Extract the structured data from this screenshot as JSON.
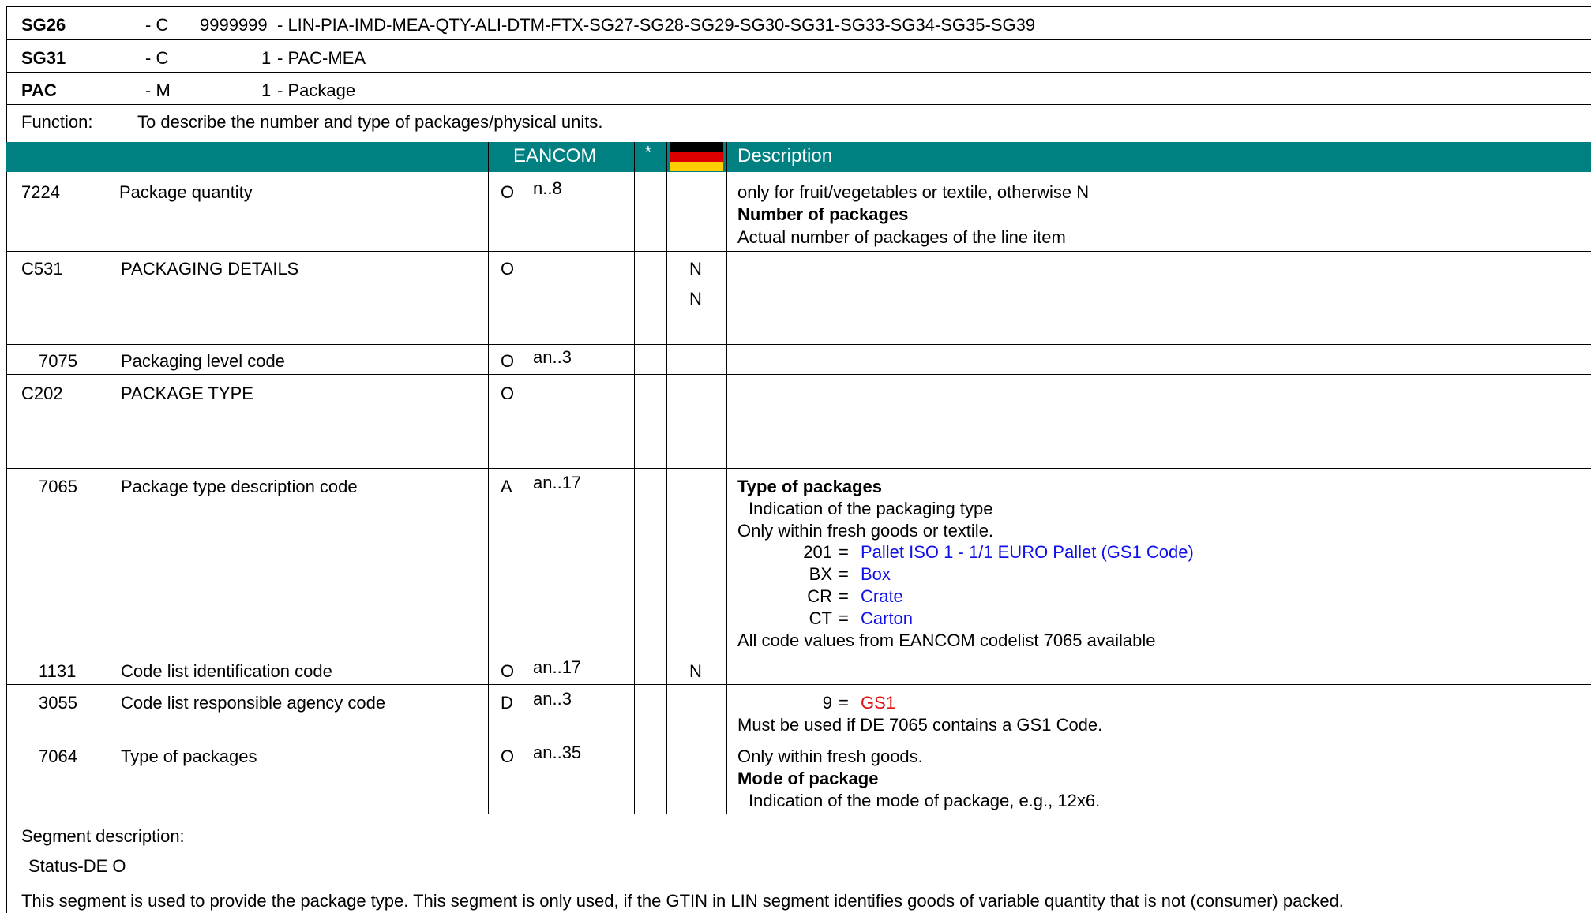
{
  "header_rows": [
    {
      "code": "SG26",
      "status": "- C",
      "repeat": "9999999",
      "desc": "- LIN-PIA-IMD-MEA-QTY-ALI-DTM-FTX-SG27-SG28-SG29-SG30-SG31-SG33-SG34-SG35-SG39"
    },
    {
      "code": "SG31",
      "status": "- C",
      "repeat": "1",
      "desc": "- PAC-MEA"
    },
    {
      "code": "PAC",
      "status": "- M",
      "repeat": "1",
      "desc": "-  Package"
    }
  ],
  "function": {
    "label": "Function:",
    "text": "To describe the number and type of packages/physical units."
  },
  "table_header": {
    "eancom": "EANCOM",
    "star": "*",
    "description": "Description"
  },
  "flag_colors": [
    "#000000",
    "#dd0000",
    "#ffce00"
  ],
  "rows": [
    {
      "tag": "7224",
      "name": "Package quantity",
      "st": "O",
      "fmt": "n..8",
      "n": "",
      "d1": "only for fruit/vegetables or textile, otherwise N",
      "d2": "Number of packages",
      "d3": "Actual number of packages of the line item"
    },
    {
      "tag": "C531",
      "name": "PACKAGING DETAILS",
      "st": "O",
      "fmt": "",
      "n": "N",
      "n2": "N"
    },
    {
      "tag": "7075",
      "name": "Packaging level code",
      "st": "O",
      "fmt": "an..3",
      "n": ""
    },
    {
      "tag": "C202",
      "name": "PACKAGE TYPE",
      "st": "O",
      "fmt": "",
      "n": ""
    },
    {
      "tag": "7065",
      "name": "Package type description code",
      "st": "A",
      "fmt": "an..17",
      "n": "",
      "d1": "Type of packages",
      "d2": "Indication of the packaging type",
      "d3": "Only within fresh goods or textile.",
      "codes": [
        {
          "code": "201",
          "eq": "=",
          "label": "Pallet ISO 1 - 1/1 EURO Pallet (GS1 Code)"
        },
        {
          "code": "BX",
          "eq": "=",
          "label": "Box"
        },
        {
          "code": "CR",
          "eq": "=",
          "label": "Crate"
        },
        {
          "code": "CT",
          "eq": "=",
          "label": "Carton"
        }
      ],
      "d4": "All code values from EANCOM codelist 7065 available"
    },
    {
      "tag": "1131",
      "name": "Code list identification code",
      "st": "O",
      "fmt": "an..17",
      "n": "N"
    },
    {
      "tag": "3055",
      "name": "Code list responsible agency code",
      "st": "D",
      "fmt": "an..3",
      "n": "",
      "code": {
        "code": "9",
        "eq": "=",
        "label": "GS1"
      },
      "d1": "Must be used if DE 7065 contains a GS1 Code."
    },
    {
      "tag": "7064",
      "name": "Type of packages",
      "st": "O",
      "fmt": "an..35",
      "n": "",
      "d1": "Only within fresh goods.",
      "d2": "Mode of package",
      "d3": "Indication of the mode of package, e.g., 12x6."
    }
  ],
  "segment": {
    "label": "Segment description:",
    "status": "Status-DE O",
    "text": "This segment is used to provide the package type. This segment is only used, if the GTIN in LIN segment identifies goods of variable quantity that is not (consumer) packed."
  }
}
